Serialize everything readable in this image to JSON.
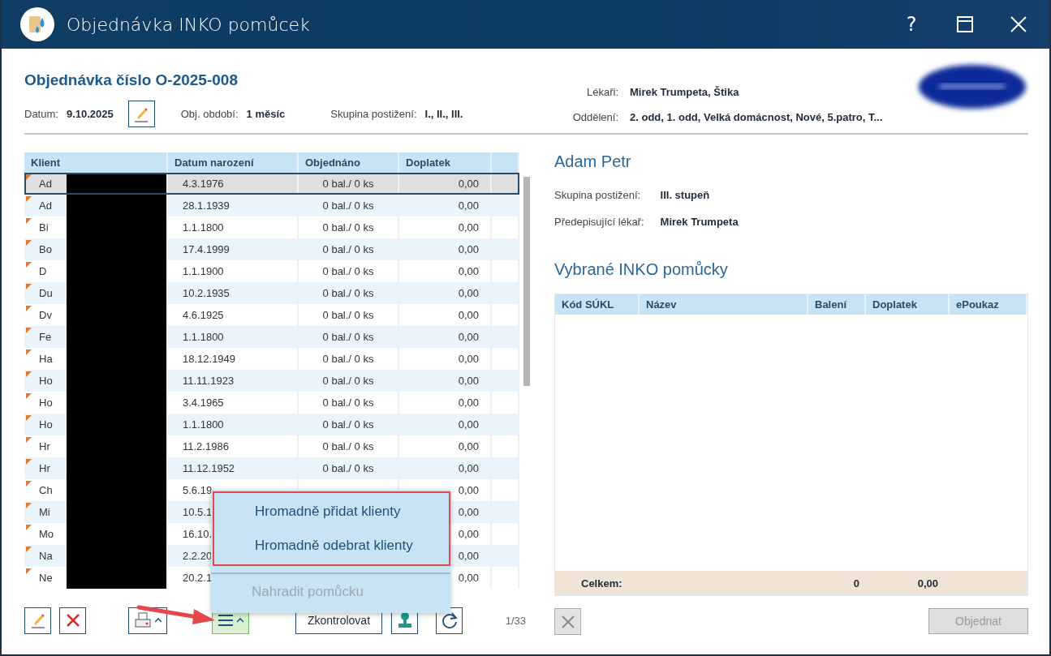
{
  "window": {
    "title": "Objednávka INKO pomůcek",
    "help": "?"
  },
  "order": {
    "title": "Objednávka číslo O-2025-008",
    "fields": [
      {
        "kind": "field",
        "label": "Datum:",
        "value": "9.10.2025"
      },
      {
        "kind": "edit_button"
      },
      {
        "kind": "field",
        "label": "Obj. období:",
        "value": "1 měsíc"
      },
      {
        "kind": "field",
        "label": "Skupina postižení:",
        "value": "I., II., III."
      }
    ],
    "side_fields": [
      {
        "label": "Lékaři:",
        "value": "Mirek Trumpeta, Štika"
      },
      {
        "label": "Oddělení:",
        "value": "2. odd, 1. odd, Velká domácnost, Nové, 5.patro, T..."
      }
    ]
  },
  "clients": {
    "columns": [
      "Klient",
      "Datum narození",
      "Objednáno",
      "Doplatek"
    ],
    "rows": [
      {
        "client": "Ad",
        "birth": "4.3.1976",
        "ordered": "0 bal./ 0 ks",
        "surcharge": "0,00",
        "selected": true
      },
      {
        "client": "Ad",
        "birth": "28.1.1939",
        "ordered": "0 bal./ 0 ks",
        "surcharge": "0,00",
        "selected": false
      },
      {
        "client": "Bi",
        "birth": "1.1.1800",
        "ordered": "0 bal./ 0 ks",
        "surcharge": "0,00",
        "selected": false
      },
      {
        "client": "Bo",
        "birth": "17.4.1999",
        "ordered": "0 bal./ 0 ks",
        "surcharge": "0,00",
        "selected": false
      },
      {
        "client": "D",
        "birth": "1.1.1900",
        "ordered": "0 bal./ 0 ks",
        "surcharge": "0,00",
        "selected": false
      },
      {
        "client": "Du",
        "birth": "10.2.1935",
        "ordered": "0 bal./ 0 ks",
        "surcharge": "0,00",
        "selected": false
      },
      {
        "client": "Dv",
        "birth": "4.6.1925",
        "ordered": "0 bal./ 0 ks",
        "surcharge": "0,00",
        "selected": false
      },
      {
        "client": "Fe",
        "birth": "1.1.1800",
        "ordered": "0 bal./ 0 ks",
        "surcharge": "0,00",
        "selected": false
      },
      {
        "client": "Ha",
        "birth": "18.12.1949",
        "ordered": "0 bal./ 0 ks",
        "surcharge": "0,00",
        "selected": false
      },
      {
        "client": "Ho",
        "birth": "11.11.1923",
        "ordered": "0 bal./ 0 ks",
        "surcharge": "0,00",
        "selected": false
      },
      {
        "client": "Ho",
        "birth": "3.4.1965",
        "ordered": "0 bal./ 0 ks",
        "surcharge": "0,00",
        "selected": false
      },
      {
        "client": "Ho",
        "birth": "1.1.1800",
        "ordered": "0 bal./ 0 ks",
        "surcharge": "0,00",
        "selected": false
      },
      {
        "client": "Hr",
        "birth": "11.2.1986",
        "ordered": "0 bal./ 0 ks",
        "surcharge": "0,00",
        "selected": false
      },
      {
        "client": "Hr",
        "birth": "11.12.1952",
        "ordered": "0 bal./ 0 ks",
        "surcharge": "0,00",
        "selected": false
      },
      {
        "client": "Ch",
        "birth": "5.6.19",
        "surcharge": "0,00",
        "selected": false
      },
      {
        "client": "Mi",
        "birth": "10.5.1",
        "surcharge": "0,00",
        "selected": false
      },
      {
        "client": "Mo",
        "birth": "16.10.",
        "surcharge": "0,00",
        "selected": false
      },
      {
        "client": "Na",
        "birth": "2.2.20",
        "surcharge": "0,00",
        "selected": false
      },
      {
        "client": "Ne",
        "birth": "20.2.1",
        "surcharge": "0,00",
        "selected": false
      }
    ]
  },
  "toolbar": {
    "menu_expanded": true,
    "check_button": "Zkontrolovat",
    "pager": "1/33"
  },
  "menu": {
    "items": [
      {
        "label": "Hromadně přidat klienty",
        "disabled": false,
        "highlighted": true
      },
      {
        "label": "Hromadně odebrat klienty",
        "disabled": false,
        "highlighted": true
      },
      {
        "label": "Nahradit pomůcku",
        "disabled": true,
        "highlighted": false
      }
    ]
  },
  "detail": {
    "name": "Adam Petr",
    "fields": [
      {
        "label": "Skupina postižení:",
        "value": "III. stupeň"
      },
      {
        "label": "Předepisující lékař:",
        "value": "Mirek Trumpeta"
      }
    ],
    "section_title": "Vybrané INKO pomůcky",
    "columns": [
      "Kód SÚKL",
      "Název",
      "Balení",
      "Doplatek",
      "ePoukaz"
    ],
    "total": {
      "label": "Celkem:",
      "packages": "0",
      "surcharge": "0,00"
    },
    "remove_disabled": true,
    "order_button": {
      "label": "Objednat",
      "disabled": true
    }
  }
}
